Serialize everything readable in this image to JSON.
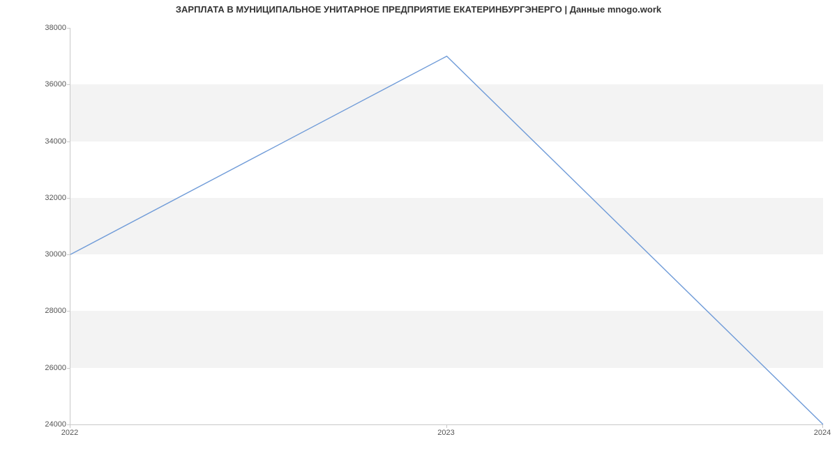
{
  "chart_data": {
    "type": "line",
    "title": "ЗАРПЛАТА В МУНИЦИПАЛЬНОЕ УНИТАРНОЕ ПРЕДПРИЯТИЕ ЕКАТЕРИНБУРГЭНЕРГО | Данные mnogo.work",
    "x": [
      2022,
      2023,
      2024
    ],
    "values": [
      30000,
      37000,
      24000
    ],
    "xlabel": "",
    "ylabel": "",
    "xlim": [
      2022,
      2024
    ],
    "ylim": [
      24000,
      38000
    ],
    "yticks": [
      24000,
      26000,
      28000,
      30000,
      32000,
      34000,
      36000,
      38000
    ],
    "xticks": [
      2022,
      2023,
      2024
    ],
    "line_color": "#6f9bd8"
  }
}
